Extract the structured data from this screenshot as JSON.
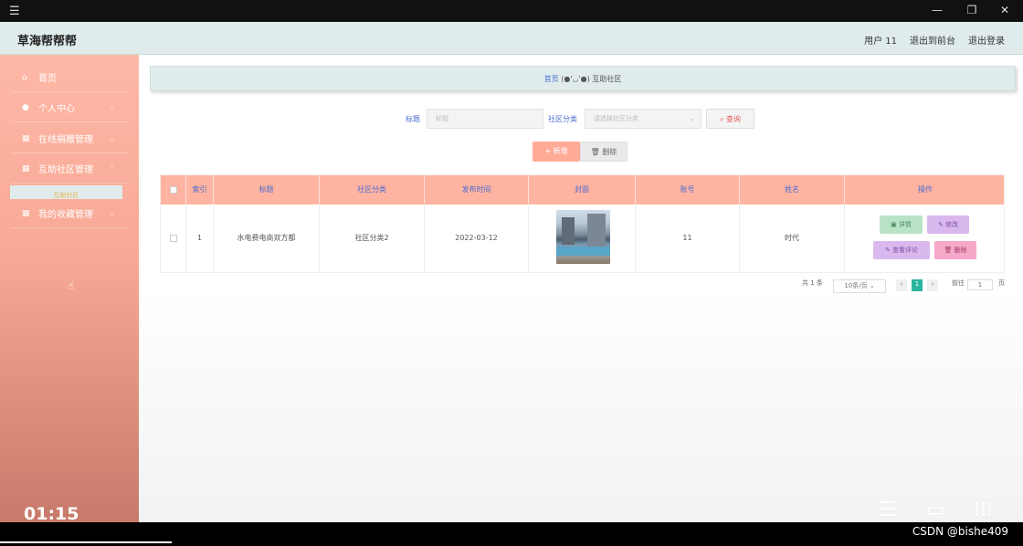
{
  "window": {
    "menu_icon": "hamburger-icon",
    "min": "—",
    "restore": "❐",
    "close": "✕"
  },
  "app": {
    "title": "草海帮帮帮"
  },
  "header": {
    "user": "用户 11",
    "back_front": "退出到前台",
    "logout": "退出登录"
  },
  "sidebar": {
    "items": [
      {
        "label": "首页",
        "icon": "home-icon"
      },
      {
        "label": "个人中心",
        "icon": "user-icon"
      },
      {
        "label": "在线捐赠管理",
        "icon": "grid-icon"
      },
      {
        "label": "互助社区管理",
        "icon": "grid-icon"
      },
      {
        "label": "我的收藏管理",
        "icon": "grid-icon"
      }
    ],
    "sub_item": "互助社区"
  },
  "breadcrumb": {
    "home": "首页",
    "emoticon": "(●'◡'●)",
    "current": "互助社区"
  },
  "search": {
    "title_label": "标题",
    "title_placeholder": "标题",
    "category_label": "社区分类",
    "category_placeholder": "请选择社区分类",
    "query_button": "查询"
  },
  "actions": {
    "add": "新增",
    "delete": "删除"
  },
  "table": {
    "headers": [
      "索引",
      "标题",
      "社区分类",
      "发布时间",
      "封面",
      "账号",
      "姓名",
      "操作"
    ],
    "rows": [
      {
        "index": "1",
        "title": "水电费电商双方都",
        "category": "社区分类2",
        "date": "2022-03-12",
        "account": "11",
        "name": "时代",
        "ops": {
          "detail": "详情",
          "edit": "修改",
          "comments": "查看评论",
          "delete": "删除"
        }
      }
    ]
  },
  "pagination": {
    "total": "共 1 条",
    "page_size": "10条/页",
    "current_page": "1",
    "goto": "前往",
    "goto_value": "1",
    "page_unit": "页"
  },
  "video": {
    "time": "01:15",
    "watermark": "CSDN @bishe409",
    "progress": 0.168
  },
  "colors": {
    "header_bg": "#dfeceb",
    "sidebar_bg": "#f7a894",
    "table_head": "#ffb3a1",
    "accent_blue": "#4a6ed1"
  }
}
